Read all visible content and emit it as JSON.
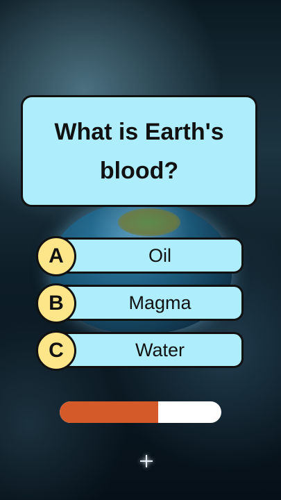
{
  "quiz": {
    "question": "What is Earth's blood?",
    "options": [
      {
        "letter": "A",
        "label": "Oil"
      },
      {
        "letter": "B",
        "label": "Magma"
      },
      {
        "letter": "C",
        "label": "Water"
      }
    ]
  },
  "timer": {
    "remaining_fraction": 0.61,
    "fill_color": "#d45a2a",
    "track_color": "#ffffff"
  },
  "colors": {
    "card": "#aeeefc",
    "badge": "#fde58a",
    "outline": "#111111"
  }
}
